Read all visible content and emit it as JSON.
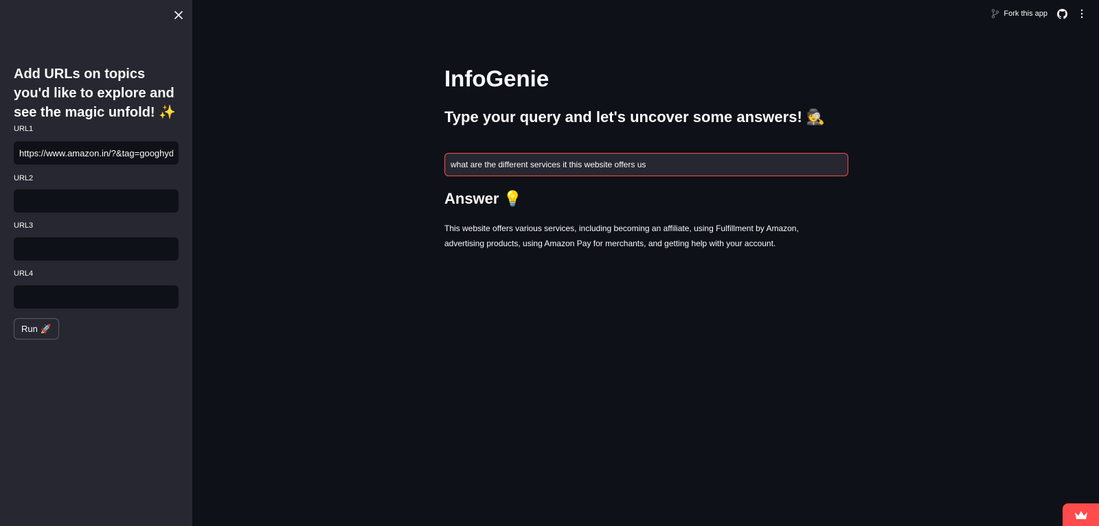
{
  "sidebar": {
    "heading": "Add URLs on topics you'd like to explore and see the magic unfold! ✨",
    "fields": [
      {
        "label": "URL1",
        "value": "https://www.amazon.in/?&tag=googhydr"
      },
      {
        "label": "URL2",
        "value": ""
      },
      {
        "label": "URL3",
        "value": ""
      },
      {
        "label": "URL4",
        "value": ""
      }
    ],
    "run_label": "Run 🚀"
  },
  "toolbar": {
    "fork_label": "Fork this app"
  },
  "main": {
    "title": "InfoGenie",
    "subtitle": "Type your query and let's uncover some answers! 🕵",
    "query_value": "what are the different services it this website offers us",
    "answer_heading": "Answer 💡",
    "answer_text": "This website offers various services, including becoming an affiliate, using Fulfillment by Amazon, advertising products, using Amazon Pay for merchants, and getting help with your account."
  },
  "colors": {
    "background": "#0e1117",
    "sidebar": "#262730",
    "accent": "#ff4b4b",
    "text": "#fafafa"
  },
  "icons": {
    "close": "close-icon",
    "fork": "fork-icon",
    "github": "github-icon",
    "badge": "crown-icon"
  }
}
